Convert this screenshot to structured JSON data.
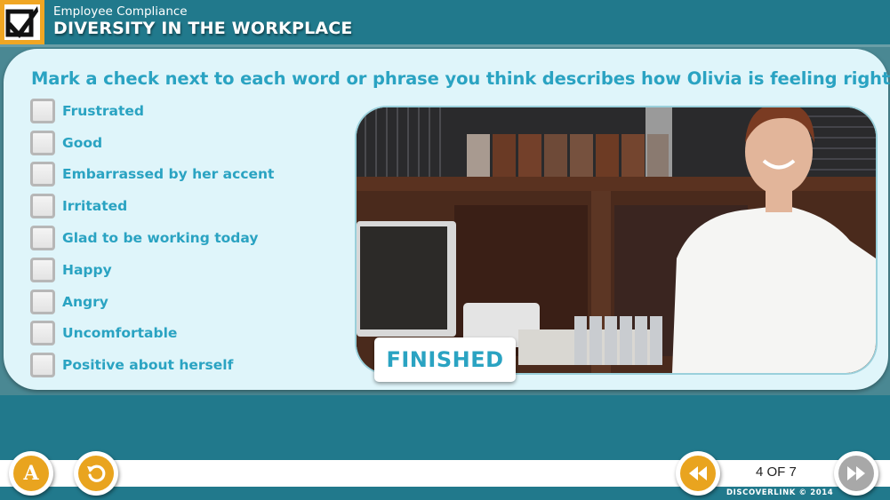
{
  "header": {
    "subtitle": "Employee Compliance",
    "title": "DIVERSITY IN THE WORKPLACE",
    "logo_icon": "checkbox-check-icon",
    "brand_color": "#f0a623",
    "bar_color": "#21798c"
  },
  "question": {
    "prompt": "Mark a check next to each word or phrase you think describes how Olivia is feeling right now.",
    "text_color": "#2aa3c2",
    "options": [
      {
        "label": "Frustrated",
        "checked": false
      },
      {
        "label": "Good",
        "checked": false
      },
      {
        "label": "Embarrassed by her accent",
        "checked": false
      },
      {
        "label": "Irritated",
        "checked": false
      },
      {
        "label": "Glad to be working today",
        "checked": false
      },
      {
        "label": "Happy",
        "checked": false
      },
      {
        "label": "Angry",
        "checked": false
      },
      {
        "label": "Uncomfortable",
        "checked": false
      },
      {
        "label": "Positive about herself",
        "checked": false
      }
    ]
  },
  "media": {
    "description": "Smiling woman in white shirt at a restaurant counter"
  },
  "finished_button": {
    "label": "FINISHED"
  },
  "footer": {
    "glossary_button": {
      "icon": "letter-a-icon",
      "glyph": "A"
    },
    "replay_button": {
      "icon": "replay-icon"
    },
    "back_button": {
      "icon": "rewind-icon"
    },
    "next_button": {
      "icon": "fast-forward-icon"
    },
    "page_indicator": "4 OF 7",
    "copyright": "DISCOVERLINK  © 2014"
  }
}
